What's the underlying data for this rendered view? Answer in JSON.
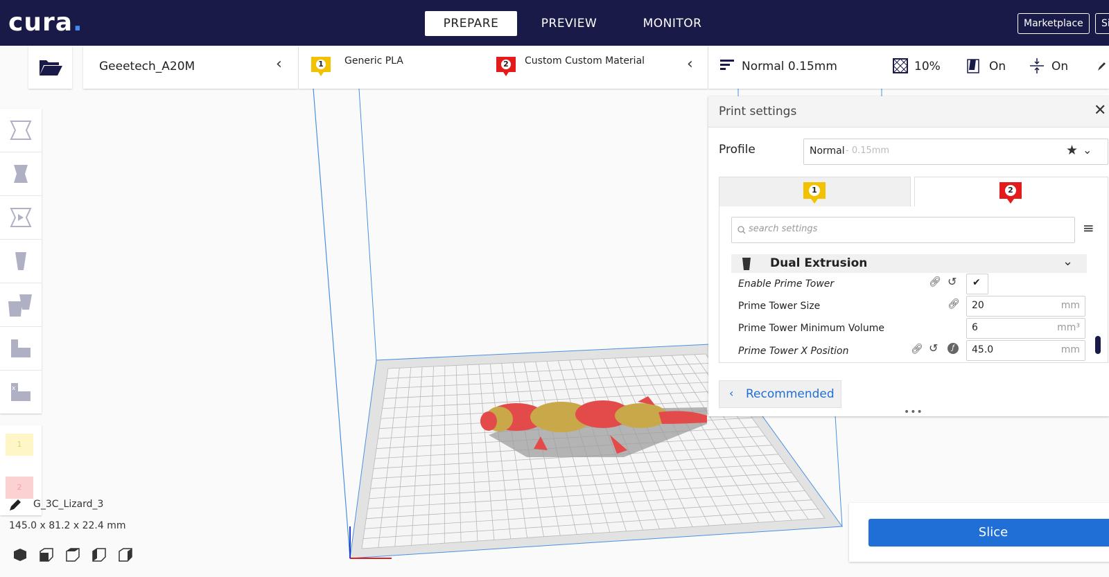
{
  "app": {
    "logo_text": "cura",
    "logo_dot": ".",
    "modes": [
      {
        "label": "PREPARE"
      },
      {
        "label": "PREVIEW"
      },
      {
        "label": "MONITOR"
      }
    ],
    "marketplace_label": "Marketplace",
    "signin_label": "Sign in"
  },
  "toolbar": {
    "printer_name": "Geeetech_A20M",
    "extruders": [
      {
        "number": "1",
        "material": "Generic PLA",
        "color": "#f2c200"
      },
      {
        "number": "2",
        "material": "Custom Custom Material",
        "color": "#e31b1b"
      }
    ],
    "profile_summary": "Normal 0.15mm",
    "infill": "10%",
    "support": "On",
    "adhesion": "On"
  },
  "print_settings": {
    "title": "Print settings",
    "profile_label": "Profile",
    "profile_name": "Normal",
    "profile_detail": " - 0.15mm",
    "tabs": [
      {
        "number": "1",
        "color": "#f2c200"
      },
      {
        "number": "2",
        "color": "#e31b1b"
      }
    ],
    "search_placeholder": "search settings",
    "category": "Dual Extrusion",
    "settings": [
      {
        "label": "Enable Prime Tower",
        "value": "",
        "unit": ""
      },
      {
        "label": "Prime Tower Size",
        "value": "20",
        "unit": "mm"
      },
      {
        "label": "Prime Tower Minimum Volume",
        "value": "6",
        "unit": "mm³"
      },
      {
        "label": "Prime Tower X Position",
        "value": "45.0",
        "unit": "mm"
      }
    ],
    "recommended_label": "Recommended"
  },
  "object": {
    "name": "G_3C_Lizard_3",
    "dimensions": "145.0 x 81.2 x 22.4 mm"
  },
  "left_extruders": [
    "1",
    "2"
  ],
  "slice_label": "Slice",
  "colors": {
    "header": "#191a48",
    "accent": "#1f6fd6",
    "extruder1": "#f2c200",
    "extruder2": "#e31b1b"
  }
}
